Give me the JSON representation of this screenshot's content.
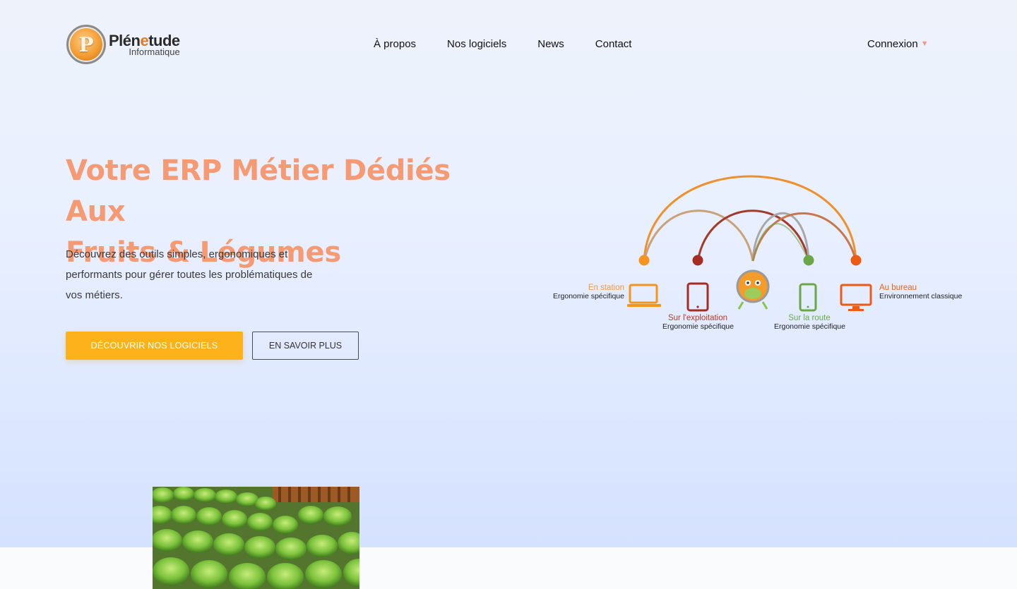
{
  "brand": {
    "name_part1": "Plén",
    "name_accent": "e",
    "name_part2": "tude",
    "tagline": "Informatique",
    "monogram": "P"
  },
  "nav": {
    "items": [
      "À propos",
      "Nos logiciels",
      "News",
      "Contact"
    ]
  },
  "login": {
    "label": "Connexion",
    "caret": "▼"
  },
  "hero": {
    "title_line1": "Votre ERP Métier Dédiés Aux",
    "title_line2": "Fruits & Légumes",
    "description": "Découvrez des outils simples, ergonomiques et performants pour gérer toutes les problématiques de vos métiers.",
    "primary_button": "DÉCOUVRIR NOS LOGICIELS",
    "secondary_button": "EN SAVOIR PLUS"
  },
  "illustration": {
    "labels": [
      {
        "title": "En station",
        "subtitle": "Ergonomie spécifique",
        "color": "#f39a3a"
      },
      {
        "title": "Sur l'exploitation",
        "subtitle": "Ergonomie spécifique",
        "color": "#b33a2a"
      },
      {
        "title": "Sur la route",
        "subtitle": "Ergonomie spécifique",
        "color": "#6aa84f"
      },
      {
        "title": "Au bureau",
        "subtitle": "Environnement classique",
        "color": "#e86414"
      }
    ]
  },
  "colors": {
    "accent": "#f59a72",
    "primary_button": "#fdb21c",
    "background": "#e8efff"
  }
}
